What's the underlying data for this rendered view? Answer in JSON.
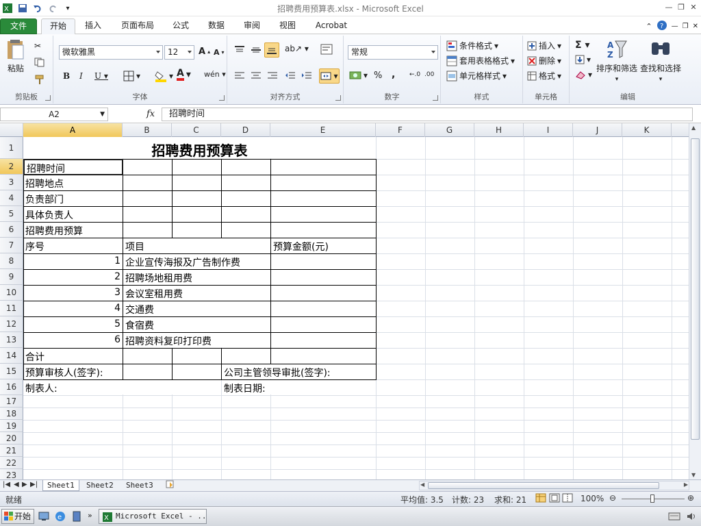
{
  "window": {
    "title": "招聘费用预算表.xlsx  -  Microsoft Excel"
  },
  "ribbon_tabs": [
    "文件",
    "开始",
    "插入",
    "页面布局",
    "公式",
    "数据",
    "审阅",
    "视图",
    "Acrobat"
  ],
  "ribbon": {
    "clipboard": {
      "paste": "粘贴",
      "label": "剪贴板"
    },
    "font": {
      "name": "微软雅黑",
      "size": "12",
      "label": "字体"
    },
    "alignment": {
      "label": "对齐方式"
    },
    "number": {
      "format": "常规",
      "label": "数字"
    },
    "styles": {
      "conditional": "条件格式",
      "table": "套用表格格式",
      "cell": "单元格样式",
      "label": "样式"
    },
    "cells": {
      "insert": "插入",
      "delete": "删除",
      "format": "格式",
      "label": "单元格"
    },
    "editing": {
      "sort": "排序和筛选",
      "find": "查找和选择",
      "label": "编辑"
    }
  },
  "formula_bar": {
    "name_box": "A2",
    "fx": "fx",
    "content": "招聘时间"
  },
  "columns": [
    "A",
    "B",
    "C",
    "D",
    "E",
    "F",
    "G",
    "H",
    "I",
    "J",
    "K"
  ],
  "rows": [
    "1",
    "2",
    "3",
    "4",
    "5",
    "6",
    "7",
    "8",
    "9",
    "10",
    "11",
    "12",
    "13",
    "14",
    "15",
    "16",
    "17",
    "18",
    "19",
    "20",
    "21",
    "22",
    "23"
  ],
  "sheet": {
    "title": "招聘费用预算表",
    "r2": "招聘时间",
    "r3": "招聘地点",
    "r4": "负责部门",
    "r5": "具体负责人",
    "r6": "招聘费用预算",
    "r7_seq": "序号",
    "r7_item": "项目",
    "r7_amount": "预算金额(元)",
    "items": [
      {
        "no": "1",
        "name": "企业宣传海报及广告制作费"
      },
      {
        "no": "2",
        "name": "招聘场地租用费"
      },
      {
        "no": "3",
        "name": "会议室租用费"
      },
      {
        "no": "4",
        "name": "交通费"
      },
      {
        "no": "5",
        "name": "食宿费"
      },
      {
        "no": "6",
        "name": "招聘资料复印打印费"
      }
    ],
    "r14": "合计",
    "r15_a": "预算审核人(签字):",
    "r15_d": "公司主管领导审批(签字):",
    "r16_a": "制表人:",
    "r16_d": "制表日期:"
  },
  "sheet_tabs": [
    "Sheet1",
    "Sheet2",
    "Sheet3"
  ],
  "status": {
    "ready": "就绪",
    "average": "平均值: 3.5",
    "count": "计数: 23",
    "sum": "求和: 21",
    "zoom": "100%"
  },
  "taskbar": {
    "start": "开始",
    "task": "Microsoft Excel - ..."
  }
}
